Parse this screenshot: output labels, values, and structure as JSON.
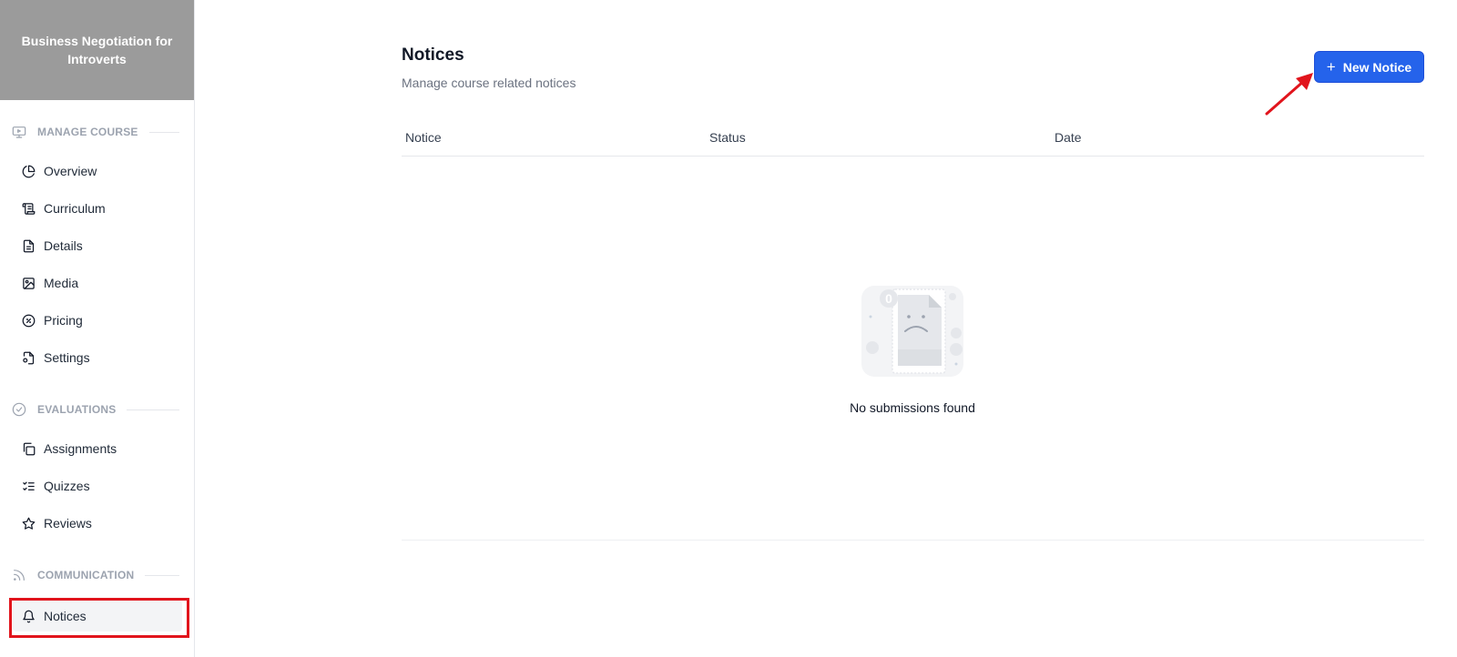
{
  "sidebar": {
    "course_title": "Business Negotiation for Introverts",
    "sections": [
      {
        "label": "MANAGE COURSE",
        "icon": "monitor-icon",
        "items": [
          {
            "label": "Overview",
            "icon": "pie-chart-icon"
          },
          {
            "label": "Curriculum",
            "icon": "scroll-icon"
          },
          {
            "label": "Details",
            "icon": "file-text-icon"
          },
          {
            "label": "Media",
            "icon": "image-icon"
          },
          {
            "label": "Pricing",
            "icon": "badge-percent-icon"
          },
          {
            "label": "Settings",
            "icon": "file-cog-icon"
          }
        ]
      },
      {
        "label": "EVALUATIONS",
        "icon": "check-circle-icon",
        "items": [
          {
            "label": "Assignments",
            "icon": "copy-icon"
          },
          {
            "label": "Quizzes",
            "icon": "list-checks-icon"
          },
          {
            "label": "Reviews",
            "icon": "star-icon"
          }
        ]
      },
      {
        "label": "COMMUNICATION",
        "icon": "rss-icon",
        "items": [
          {
            "label": "Notices",
            "icon": "bell-icon",
            "active": true
          }
        ]
      }
    ]
  },
  "main": {
    "title": "Notices",
    "subtitle": "Manage course related notices",
    "new_button": {
      "label": "New Notice",
      "icon": "plus-icon"
    },
    "table": {
      "columns": [
        "Notice",
        "Status",
        "Date"
      ],
      "rows": []
    },
    "empty_state": {
      "count_badge": "0",
      "message": "No submissions found",
      "illustration": "sad-document-icon"
    }
  },
  "colors": {
    "accent": "#2563eb",
    "course_header_bg": "#9b9b9b",
    "annotation_red": "#e1141c"
  }
}
